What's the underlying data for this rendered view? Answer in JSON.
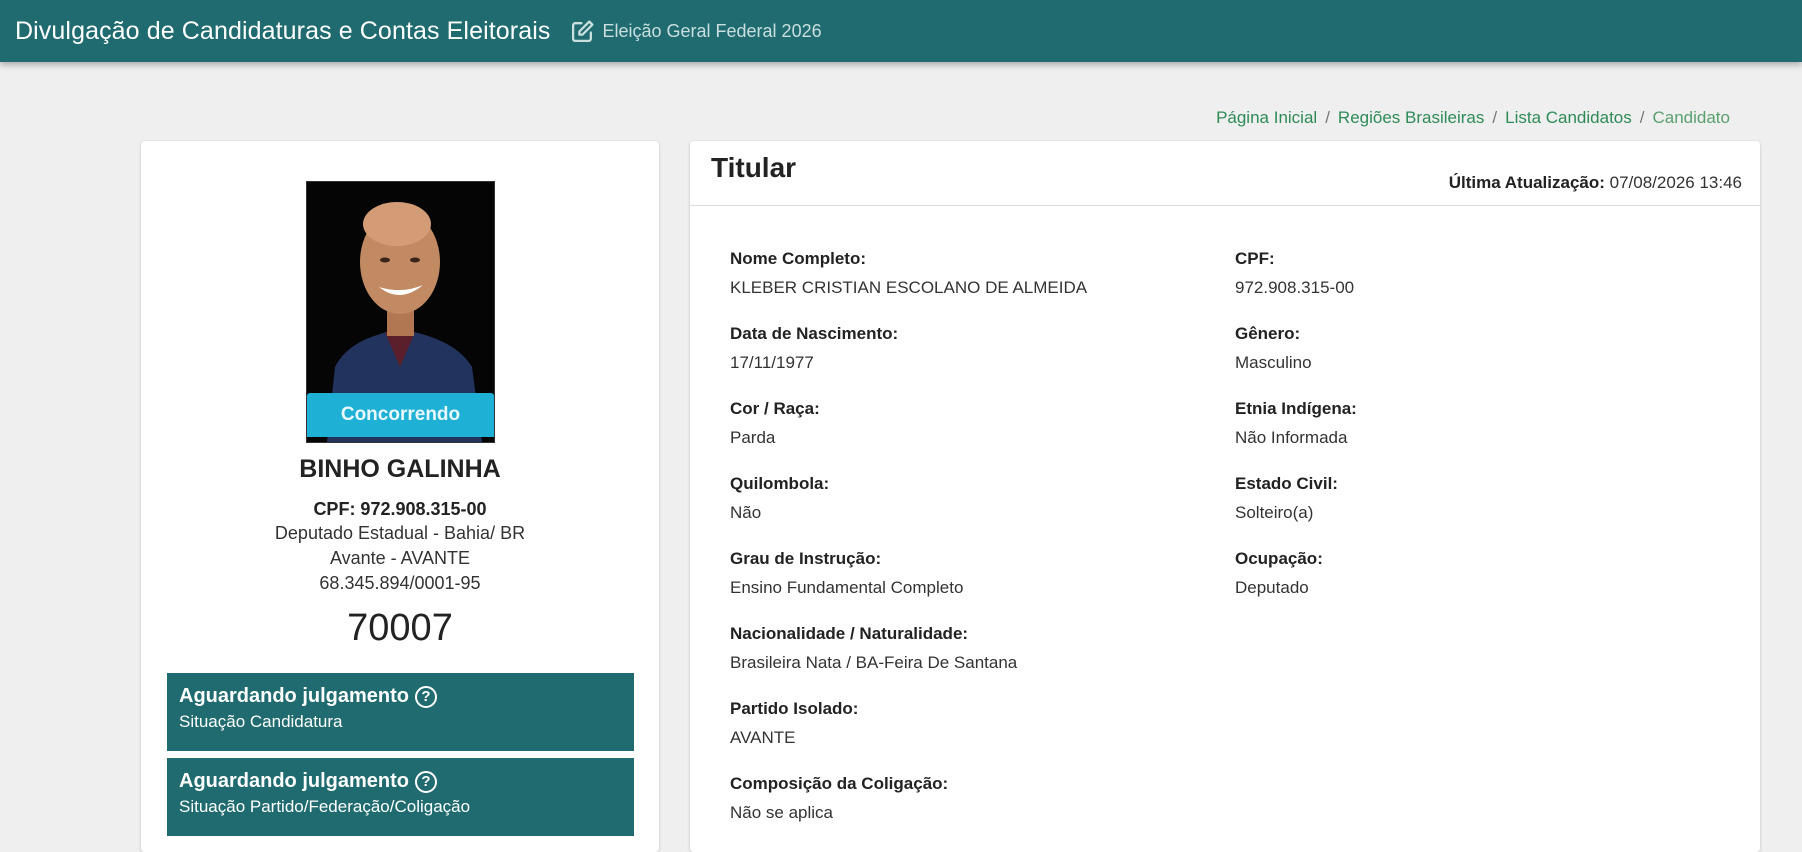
{
  "header": {
    "app_title": "Divulgação de Candidaturas e Contas Eleitorais",
    "election": "Eleição Geral Federal 2026",
    "icon": "edit-icon"
  },
  "breadcrumb": {
    "items": [
      "Página Inicial",
      "Regiões Brasileiras",
      "Lista Candidatos",
      "Candidato"
    ]
  },
  "candidate": {
    "photo_status": "Concorrendo",
    "name": "BINHO GALINHA",
    "cpf_line": "CPF: 972.908.315-00",
    "office": "Deputado Estadual - Bahia/ BR",
    "party": "Avante - AVANTE",
    "cnpj": "68.345.894/0001-95",
    "number": "70007"
  },
  "status_boxes": [
    {
      "title": "Aguardando julgamento",
      "subtitle": "Situação Candidatura"
    },
    {
      "title": "Aguardando julgamento",
      "subtitle": "Situação Partido/Federação/Coligação"
    }
  ],
  "details": {
    "title": "Titular",
    "updated_label": "Última Atualização:",
    "updated_value": "07/08/2026 13:46",
    "left": [
      {
        "label": "Nome Completo:",
        "value": "KLEBER CRISTIAN ESCOLANO DE ALMEIDA"
      },
      {
        "label": "Data de Nascimento:",
        "value": "17/11/1977"
      },
      {
        "label": "Cor / Raça:",
        "value": "Parda"
      },
      {
        "label": "Quilombola:",
        "value": "Não"
      },
      {
        "label": "Grau de Instrução:",
        "value": "Ensino Fundamental Completo"
      },
      {
        "label": "Nacionalidade / Naturalidade:",
        "value": "Brasileira Nata / BA-Feira De Santana"
      },
      {
        "label": "Partido Isolado:",
        "value": "AVANTE"
      },
      {
        "label": "Composição da Coligação:",
        "value": "Não se aplica"
      }
    ],
    "right": [
      {
        "label": "CPF:",
        "value": "972.908.315-00"
      },
      {
        "label": "Gênero:",
        "value": "Masculino"
      },
      {
        "label": "Etnia Indígena:",
        "value": "Não Informada"
      },
      {
        "label": "Estado Civil:",
        "value": "Solteiro(a)"
      },
      {
        "label": "Ocupação:",
        "value": "Deputado"
      }
    ]
  },
  "colors": {
    "header": "#1f6b6f",
    "status_box": "#1f6b6f",
    "status_pill": "#1fb0d5",
    "breadcrumb_link": "#2e8b57"
  }
}
